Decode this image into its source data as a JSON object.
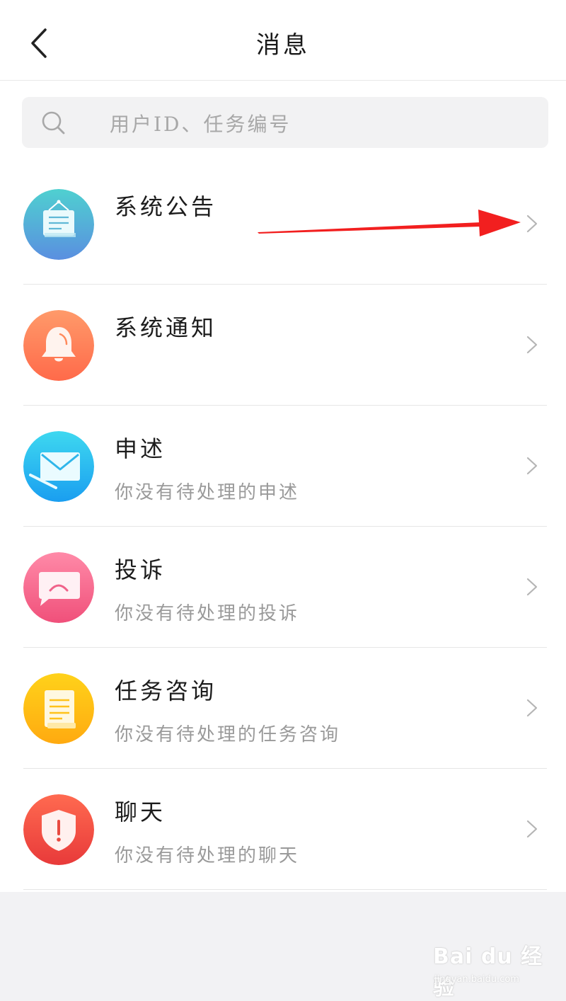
{
  "header": {
    "title": "消息",
    "back_icon": "chevron-left-icon"
  },
  "search": {
    "placeholder": "用户ID、任务编号",
    "icon": "search-icon"
  },
  "messages": [
    {
      "title": "系统公告",
      "subtitle": "",
      "icon": "notice-board-icon",
      "colors": [
        "#4fd0d0",
        "#5a8fe0"
      ]
    },
    {
      "title": "系统通知",
      "subtitle": "",
      "icon": "bell-icon",
      "colors": [
        "#ff9a6a",
        "#ff6a4a"
      ]
    },
    {
      "title": "申述",
      "subtitle": "你没有待处理的申述",
      "icon": "envelope-icon",
      "colors": [
        "#3ed8f0",
        "#1a9ef0"
      ]
    },
    {
      "title": "投诉",
      "subtitle": "你没有待处理的投诉",
      "icon": "sad-chat-icon",
      "colors": [
        "#ff8aa8",
        "#f0507a"
      ]
    },
    {
      "title": "任务咨询",
      "subtitle": "你没有待处理的任务咨询",
      "icon": "document-icon",
      "colors": [
        "#ffd21a",
        "#ffaa10"
      ]
    },
    {
      "title": "聊天",
      "subtitle": "你没有待处理的聊天",
      "icon": "alert-shield-icon",
      "colors": [
        "#ff6a50",
        "#e83a3a"
      ]
    }
  ],
  "annotation": {
    "color": "#f21f1f"
  },
  "watermark": {
    "logo_text": "Bai du 经验",
    "url": "jingyan.baidu.com"
  },
  "colors": {
    "background": "#f2f2f4",
    "surface": "#ffffff",
    "divider": "#e6e6e6",
    "title_text": "#1c1c1c",
    "subtitle_text": "#9a9a9a"
  }
}
